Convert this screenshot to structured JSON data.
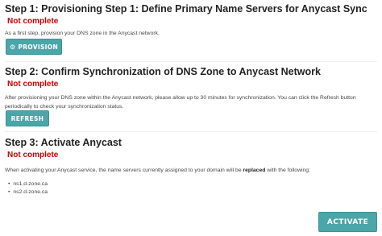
{
  "step1": {
    "title": "Step 1: Provisioning Step 1: Define Primary Name Servers for Anycast Sync",
    "status": "Not complete",
    "description": "As a first step, provision your DNS zone in the Anycast network.",
    "button_label": "PROVISION",
    "button_icon": "cogs-icon"
  },
  "step2": {
    "title": "Step 2: Confirm Synchronization of DNS Zone to Anycast Network",
    "status": "Not complete",
    "description_line1": "After provisioning your DNS zone within the Anycast network, please allow up to 30 minutes for synchronization. You can click the Refresh button",
    "description_line2": "periodically to check your synchronization status.",
    "button_label": "REFRESH"
  },
  "step3": {
    "title": "Step 3: Activate Anycast",
    "status": "Not complete",
    "description_pre": "When activating your Anycast service, the name servers currently assigned to your domain will be ",
    "description_bold": "replaced",
    "description_post": " with the following:",
    "nameservers": [
      "ns1.d-zone.ca",
      "ns2.d-zone.ca"
    ],
    "button_label": "ACTIVATE"
  },
  "colors": {
    "status_red": "#cc0000",
    "button_teal": "#4aa6a8"
  }
}
